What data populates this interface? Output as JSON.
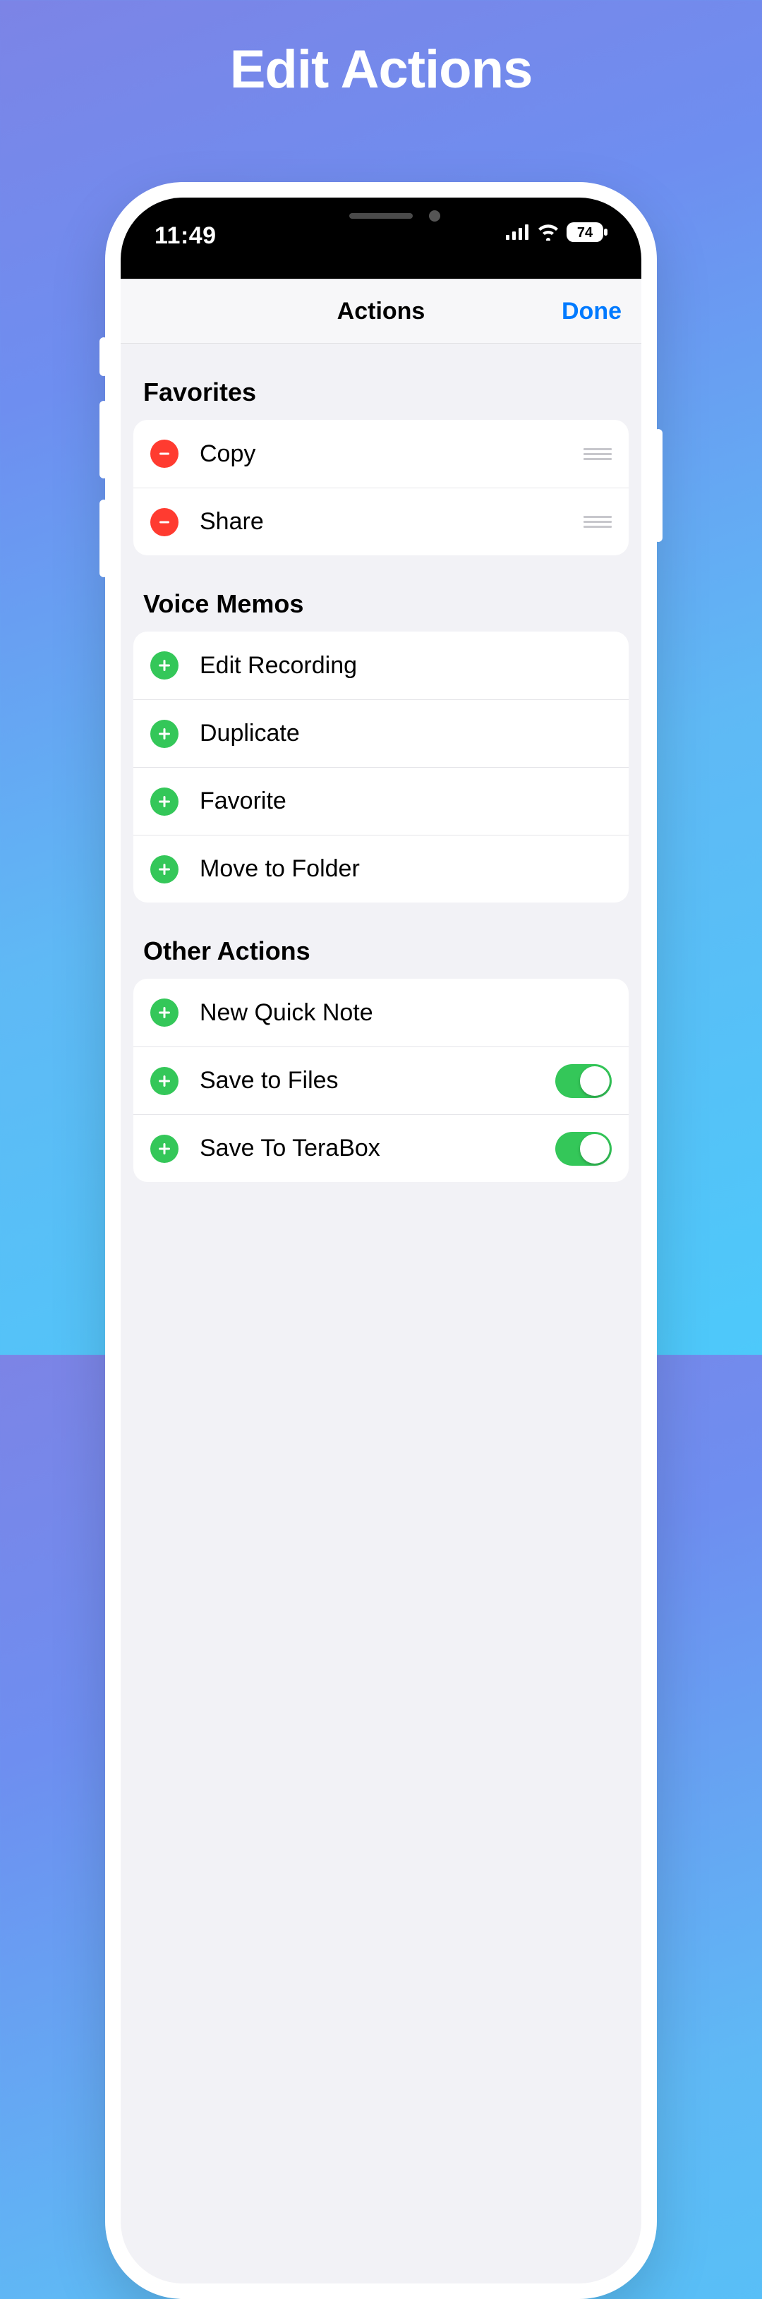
{
  "hero": {
    "title": "Edit Actions"
  },
  "status": {
    "time": "11:49",
    "battery": "74"
  },
  "sheet": {
    "title": "Actions",
    "done_label": "Done"
  },
  "sections": {
    "favorites": {
      "header": "Favorites",
      "items": [
        {
          "label": "Copy"
        },
        {
          "label": "Share"
        }
      ]
    },
    "voice_memos": {
      "header": "Voice Memos",
      "items": [
        {
          "label": "Edit Recording"
        },
        {
          "label": "Duplicate"
        },
        {
          "label": "Favorite"
        },
        {
          "label": "Move to Folder"
        }
      ]
    },
    "other": {
      "header": "Other Actions",
      "items": [
        {
          "label": "New Quick Note"
        },
        {
          "label": "Save to Files",
          "toggle": true
        },
        {
          "label": "Save To TeraBox",
          "toggle": true
        }
      ]
    }
  }
}
